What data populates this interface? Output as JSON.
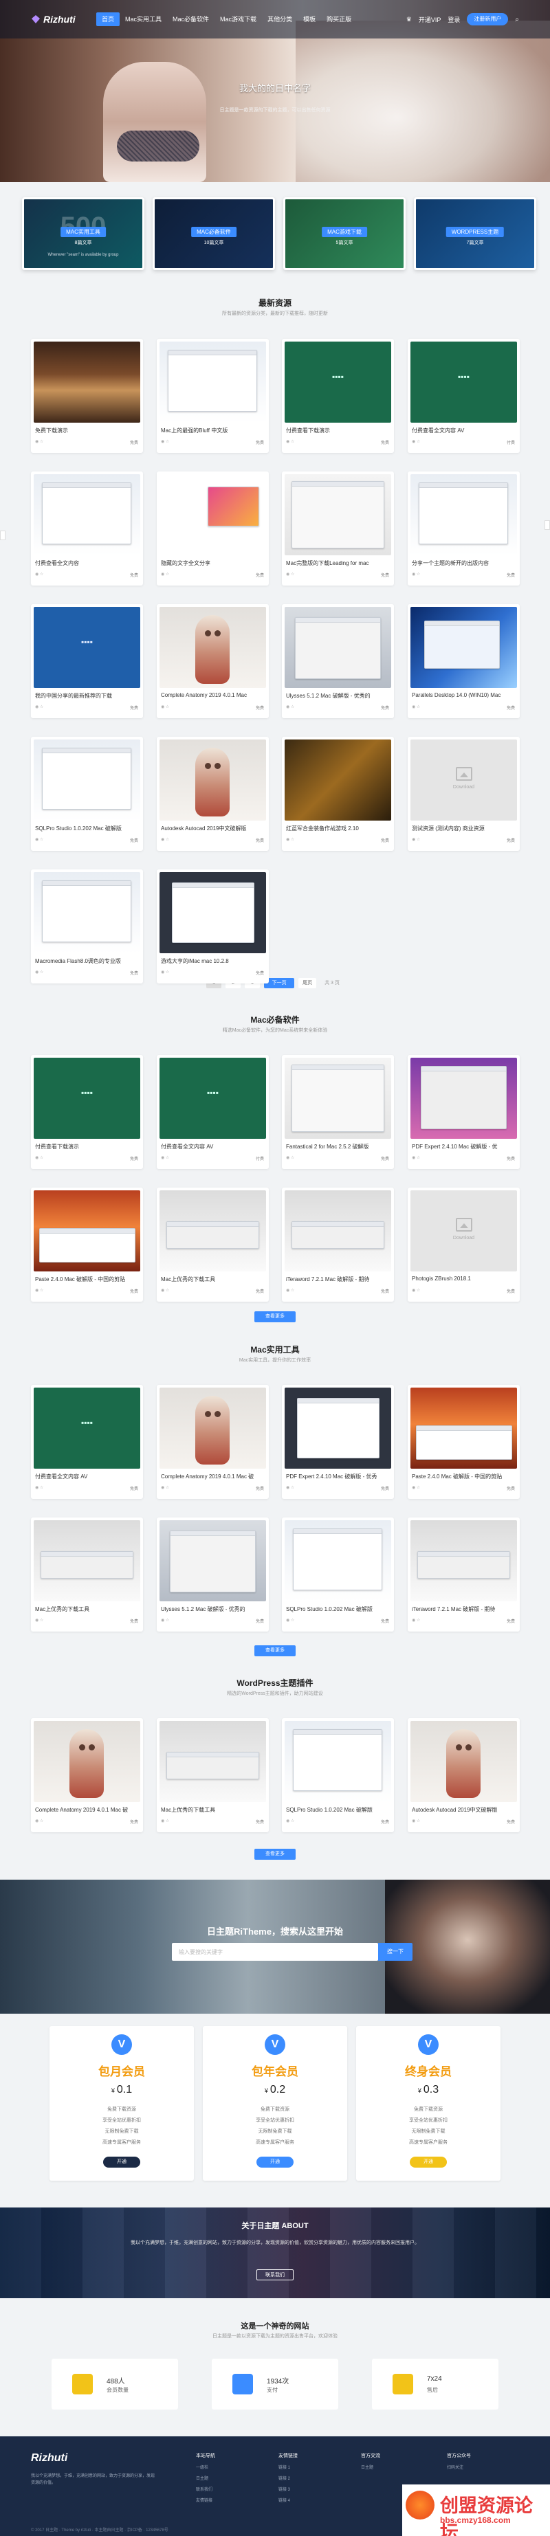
{
  "header": {
    "logo": "Rizhuti",
    "nav": [
      "首页",
      "Mac实用工具",
      "Mac必备软件",
      "Mac游戏下载",
      "其他分类",
      "模板",
      "购买正版"
    ],
    "vip": "开通VIP",
    "login": "登录",
    "register": "注册新用户"
  },
  "hero": {
    "title": "我大的的日中名字",
    "subtitle": "日主题是一款资源的下载的主题，可以出售任何资源"
  },
  "features": [
    {
      "big": "500",
      "btn": "MAC实用工具",
      "count": "8篇文章",
      "micro": "Wherever \"seam\" is available by group"
    },
    {
      "big": "",
      "btn": "MAC必备软件",
      "count": "10篇文章",
      "micro": ""
    },
    {
      "big": "",
      "btn": "MAC游戏下载",
      "count": "5篇文章",
      "micro": ""
    },
    {
      "big": "",
      "btn": "WORDPRESS主题",
      "count": "7篇文章",
      "micro": ""
    }
  ],
  "latest": {
    "title": "最新资源",
    "subtitle": "所有最新的资源分类，最新的下载推荐，随时更新",
    "items": [
      {
        "title": "免费下载演示",
        "meta": "免费"
      },
      {
        "title": "Mac上的最强的Bluff 中文版",
        "meta": "免费"
      },
      {
        "title": "付费查看下载演示",
        "meta": "免费"
      },
      {
        "title": "付费查看全文内容 AV",
        "meta": "付费"
      },
      {
        "title": "付费查看全文内容",
        "meta": "免费"
      },
      {
        "title": "隐藏的文字全文分享",
        "meta": "免费"
      },
      {
        "title": "Mac完整版的下载Leading for mac",
        "meta": "免费"
      },
      {
        "title": "分享一个主题的新开的出版内容",
        "meta": "免费"
      },
      {
        "title": "我的中国分享的最新推荐的下载",
        "meta": "免费"
      },
      {
        "title": "Complete Anatomy 2019 4.0.1 Mac",
        "meta": "免费"
      },
      {
        "title": "Ulysses 5.1.2 Mac 破解版 - 优秀的",
        "meta": "免费"
      },
      {
        "title": "Parallels Desktop 14.0 (WIN10) Mac",
        "meta": "免费"
      },
      {
        "title": "SQLPro Studio 1.0.202 Mac 破解版",
        "meta": "免费"
      },
      {
        "title": "Autodesk Autocad 2019中文破解版",
        "meta": "免费"
      },
      {
        "title": "红蓝军合金装备作战游戏 2.10",
        "meta": "免费"
      },
      {
        "title": "测试资源 (测试内容) 商业资源",
        "meta": "免费"
      },
      {
        "title": "Macromedia Flash8.0调色的专业版",
        "meta": "免费"
      },
      {
        "title": "游戏大亨的iMac mac 10.2.8",
        "meta": "免费"
      }
    ]
  },
  "pager": {
    "pages": [
      "1",
      "2",
      "3"
    ],
    "next": "下一页",
    "last": "尾页",
    "info": "共 3 页"
  },
  "mac_essential": {
    "title": "Mac必备软件",
    "subtitle": "精选Mac必备软件，为您的Mac系统带来全新体验",
    "more": "查看更多",
    "items": [
      {
        "title": "付费查看下载演示",
        "meta": "免费"
      },
      {
        "title": "付费查看全文内容 AV",
        "meta": "付费"
      },
      {
        "title": "Fantastical 2 for Mac 2.5.2 破解版",
        "meta": "免费"
      },
      {
        "title": "PDF Expert 2.4.10 Mac 破解版 - 优",
        "meta": "免费"
      },
      {
        "title": "Paste 2.4.0 Mac 破解版 - 中国的剪贴",
        "meta": "免费"
      },
      {
        "title": "Mac上优秀的下载工具",
        "meta": "免费"
      },
      {
        "title": "iTeraword 7.2.1 Mac 破解版 - 期待",
        "meta": "免费"
      },
      {
        "title": "Photogis ZBrush 2018.1",
        "meta": "免费"
      }
    ]
  },
  "mac_tools": {
    "title": "Mac实用工具",
    "subtitle": "Mac实用工具，提升你的工作效率",
    "more": "查看更多",
    "items": [
      {
        "title": "付费查看全文内容 AV",
        "meta": "免费"
      },
      {
        "title": "Complete Anatomy 2019 4.0.1 Mac 破",
        "meta": "免费"
      },
      {
        "title": "PDF Expert 2.4.10 Mac 破解版 - 优秀",
        "meta": "免费"
      },
      {
        "title": "Paste 2.4.0 Mac 破解版 - 中国的剪贴",
        "meta": "免费"
      },
      {
        "title": "Mac上优秀的下载工具",
        "meta": "免费"
      },
      {
        "title": "Ulysses 5.1.2 Mac 破解版 - 优秀的",
        "meta": "免费"
      },
      {
        "title": "SQLPro Studio 1.0.202 Mac 破解版",
        "meta": "免费"
      },
      {
        "title": "iTeraword 7.2.1 Mac 破解版 - 期待",
        "meta": "免费"
      }
    ]
  },
  "wordpress": {
    "title": "WordPress主题插件",
    "subtitle": "精选的WordPress主题和插件，助力网站建设",
    "more": "查看更多",
    "items": [
      {
        "title": "Complete Anatomy 2019 4.0.1 Mac 破",
        "meta": "免费"
      },
      {
        "title": "Mac上优秀的下载工具",
        "meta": "免费"
      },
      {
        "title": "SQLPro Studio 1.0.202 Mac 破解版",
        "meta": "免费"
      },
      {
        "title": "Autodesk Autocad 2019中文破解版",
        "meta": "免费"
      }
    ]
  },
  "search": {
    "title": "日主题RiTheme，搜索从这里开始",
    "placeholder": "输入要搜的关键字",
    "button": "搜一下"
  },
  "vip": [
    {
      "name": "包月会员",
      "price": "0.1",
      "lines": [
        "免费下载资源",
        "享受全站优惠折扣",
        "无限制免费下载",
        "高速专属客户服务"
      ],
      "btn": "开通",
      "btn_color": "#1b2a45"
    },
    {
      "name": "包年会员",
      "price": "0.2",
      "lines": [
        "免费下载资源",
        "享受全站优惠折扣",
        "无限制免费下载",
        "高速专属客户服务"
      ],
      "btn": "开通",
      "btn_color": "#3b8cff"
    },
    {
      "name": "终身会员",
      "price": "0.3",
      "lines": [
        "免费下载资源",
        "享受全站优惠折扣",
        "无限制免费下载",
        "高速专属客户服务"
      ],
      "btn": "开通",
      "btn_color": "#f2c318"
    }
  ],
  "vip_currency": "¥",
  "about": {
    "title": "关于日主题 ABOUT",
    "text": "我以个充满梦想，于维。充满创意的网站，致力于资源的分享，发现资源的价值，欣赏分享资源的魅力，用优质的内容服务来回报用户。",
    "button": "联系我们"
  },
  "magic": {
    "title": "这是一个神奇的网站",
    "subtitle": "日主题是一款以资源下载为主题的资源出售平台，欢迎体验"
  },
  "stats": [
    {
      "num": "488人",
      "label": "会员数量",
      "color": "#f2c318"
    },
    {
      "num": "1934次",
      "label": "支付",
      "color": "#3b8cff"
    },
    {
      "num": "7x24",
      "label": "售后",
      "color": "#f2c318"
    }
  ],
  "footer": {
    "logo": "Rizhuti",
    "desc": "我以个充满梦想。于维，充满创意的网站，致力于资源的分享，发现资源的价值。",
    "cols": [
      {
        "title": "本站导航",
        "items": [
          "一级栏",
          "日主题",
          "联系我们",
          "友情链接"
        ]
      },
      {
        "title": "友情链接",
        "items": [
          "链接 1",
          "链接 2",
          "链接 3",
          "链接 4"
        ]
      },
      {
        "title": "官方交流",
        "items": [
          "日主题"
        ]
      },
      {
        "title": "官方公众号",
        "items": [
          "扫码关注"
        ]
      }
    ],
    "copy": "© 2017 日主题 · Theme by riztuti · 本主题由日主题 · 京ICP备 · 12345678号"
  },
  "watermark": {
    "text": "创盟资源论坛",
    "url": "bbs.cmzy168.com"
  }
}
